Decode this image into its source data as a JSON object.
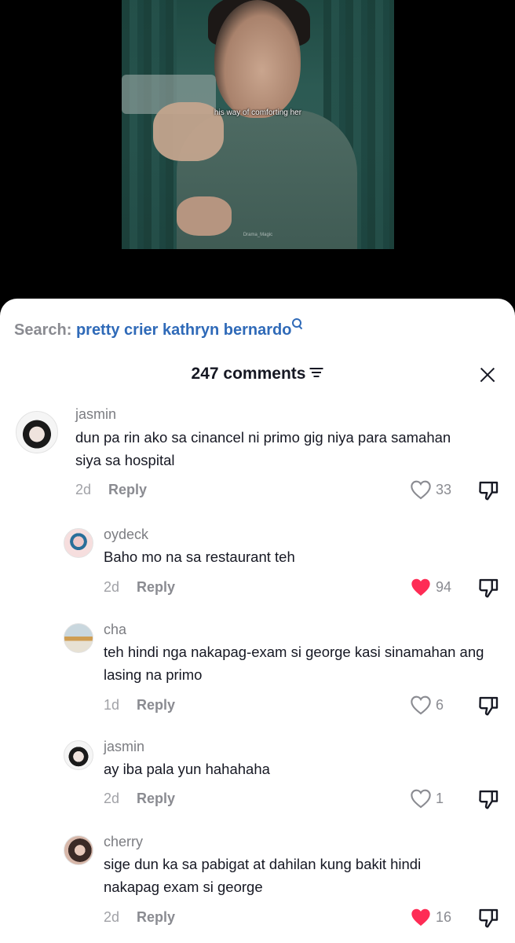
{
  "video": {
    "caption": "his way of comforting her",
    "watermark": "Drama_Magic"
  },
  "search": {
    "prefix": "Search:",
    "query": "pretty crier kathryn bernardo"
  },
  "header": {
    "count_label": "247 comments"
  },
  "colors": {
    "accent": "#2f6ab8",
    "liked": "#fe2c55"
  },
  "comments": [
    {
      "user": "jasmin",
      "text": "dun pa rin ako sa cinancel ni primo gig niya para samahan siya sa hospital",
      "age": "2d",
      "reply": "Reply",
      "likes": "33",
      "liked": false
    },
    {
      "user": "oydeck",
      "text": "Baho mo na sa restaurant teh",
      "age": "2d",
      "reply": "Reply",
      "likes": "94",
      "liked": true
    },
    {
      "user": "cha",
      "text": "teh hindi nga nakapag-exam si george kasi sinamahan ang lasing na primo",
      "age": "1d",
      "reply": "Reply",
      "likes": "6",
      "liked": false
    },
    {
      "user": "jasmin",
      "text": "ay iba pala yun hahahaha",
      "age": "2d",
      "reply": "Reply",
      "likes": "1",
      "liked": false
    },
    {
      "user": "cherry",
      "text": "sige dun ka sa pabigat at dahilan kung bakit hindi nakapag exam si george",
      "age": "2d",
      "reply": "Reply",
      "likes": "16",
      "liked": true
    }
  ]
}
